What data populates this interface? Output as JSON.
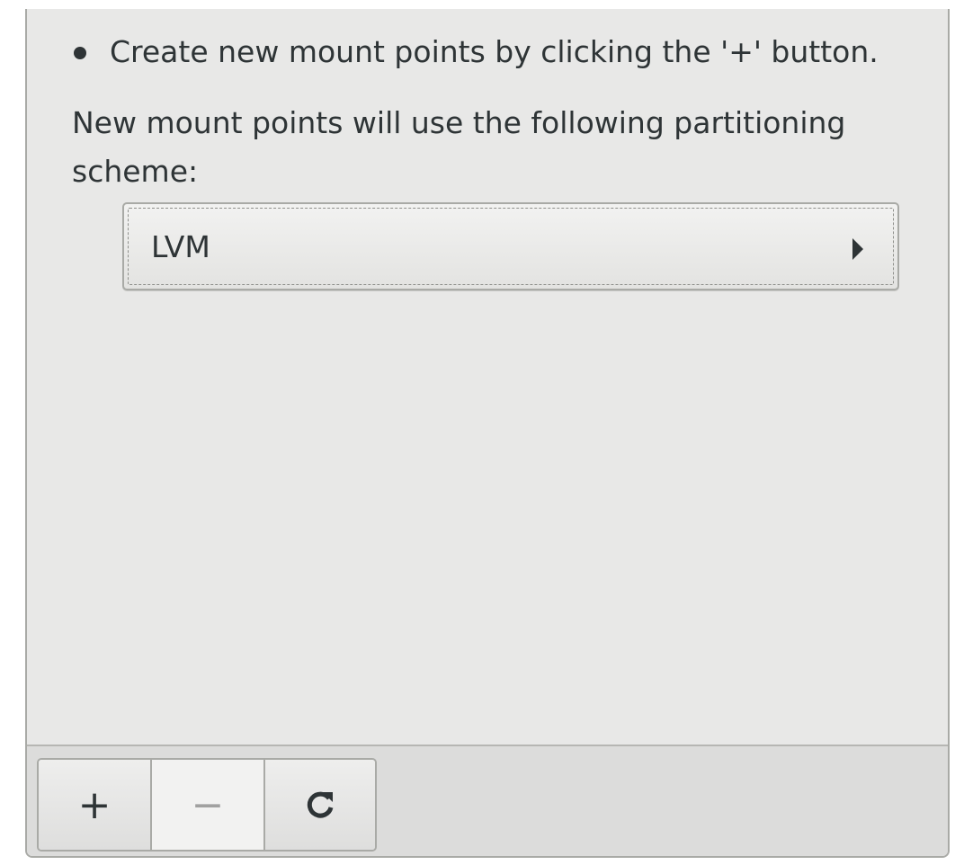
{
  "hint": {
    "bullet_text": "Create new mount points by clicking the '+' button."
  },
  "scheme": {
    "description": "New mount points will use the following partitioning scheme:",
    "selected": "LVM"
  },
  "toolbar": {
    "add_label": "+",
    "remove_label": "−",
    "refresh_label": "⟳"
  },
  "icons": {
    "dropdown": "triangle-right-icon",
    "add": "plus-icon",
    "remove": "minus-icon",
    "refresh": "refresh-icon"
  },
  "colors": {
    "panel_bg": "#e8e8e7",
    "text": "#2e3436",
    "border": "#a9aaa6",
    "disabled_text": "#a1a1a0"
  }
}
